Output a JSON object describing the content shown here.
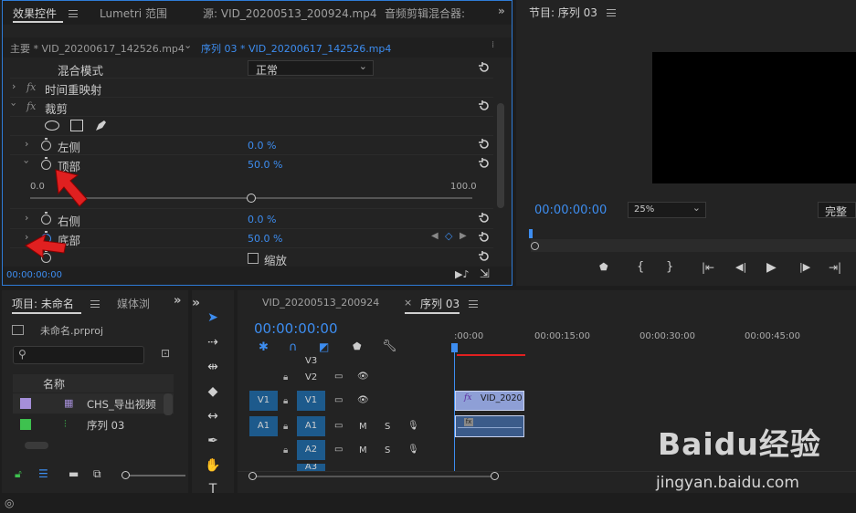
{
  "effect_controls": {
    "tabs": [
      "效果控件",
      "Lumetri 范围",
      "源: VID_20200513_200924.mp4",
      "音频剪辑混合器:"
    ],
    "master_clip": "主要 * VID_20200617_142526.mp4",
    "sequence_clip": "序列 03 * VID_20200617_142526.mp4",
    "rows": {
      "blend_mode_label": "混合模式",
      "blend_mode_value": "正常",
      "time_remap_label": "时间重映射",
      "crop_label": "裁剪",
      "left_label": "左侧",
      "left_value": "0.0 %",
      "top_label": "顶部",
      "top_value": "50.0 %",
      "slider_min": "0.0",
      "slider_max": "100.0",
      "slider_level": 0.5,
      "right_label": "右侧",
      "right_value": "0.0 %",
      "bottom_label": "底部",
      "bottom_value": "50.0 %",
      "zoom_label": "缩放"
    },
    "timecode": "00:00:00:00"
  },
  "program_monitor": {
    "title": "节目: 序列 03",
    "timecode": "00:00:00:00",
    "zoom": "25%",
    "quality": "完整"
  },
  "project": {
    "tab_project": "项目: 未命名",
    "tab_media": "媒体浏",
    "file_name": "未命名.prproj",
    "search_placeholder": "",
    "column_name": "名称",
    "items": [
      {
        "name": "CHS_导出视频",
        "color": "#a58fd9"
      },
      {
        "name": "序列 03",
        "color": "#3ec24f"
      }
    ]
  },
  "timeline": {
    "tab_clip": "VID_20200513_200924",
    "tab_sequence": "序列 03",
    "timecode": "00:00:00:00",
    "ruler": [
      ":00:00",
      "00:00:15:00",
      "00:00:30:00",
      "00:00:45:00"
    ],
    "tracks": {
      "v3": "V3",
      "v2": "V2",
      "v1_src": "V1",
      "v1": "V1",
      "a1_src": "A1",
      "a1": "A1",
      "a2": "A2",
      "a3": "A3",
      "mute": "M",
      "solo": "S"
    },
    "video_clip_label": "VID_2020"
  },
  "watermark": {
    "brand": "Baidu经验",
    "url": "jingyan.baidu.com"
  },
  "colors": {
    "accent_blue": "#3d8df0",
    "track_on": "#1d5a8c",
    "arrow_red": "#e02020",
    "clip_video": "#8e9fd6",
    "clip_audio": "#3b5b8a"
  }
}
